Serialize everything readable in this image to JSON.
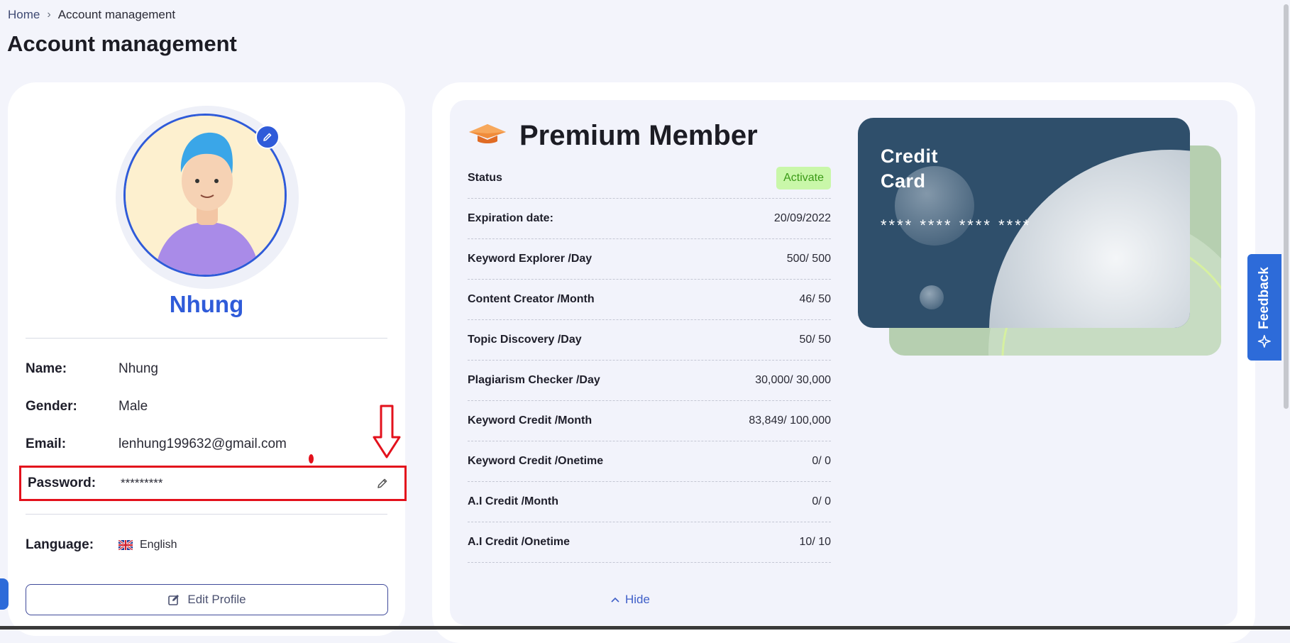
{
  "breadcrumb": {
    "home": "Home",
    "separator": "›",
    "current": "Account management"
  },
  "page_title": "Account management",
  "profile": {
    "name_display": "Nhung",
    "fields": {
      "name_label": "Name:",
      "name_value": "Nhung",
      "gender_label": "Gender:",
      "gender_value": "Male",
      "email_label": "Email:",
      "email_value": "lenhung199632@gmail.com",
      "password_label": "Password:",
      "password_value": "*********",
      "language_label": "Language:",
      "language_value": "English"
    },
    "edit_button": "Edit Profile"
  },
  "membership": {
    "title": "Premium Member",
    "rows": [
      {
        "label": "Status",
        "value": "Activate"
      },
      {
        "label": "Expiration date:",
        "value": "20/09/2022"
      },
      {
        "label": "Keyword Explorer /Day",
        "value": "500/ 500"
      },
      {
        "label": "Content Creator /Month",
        "value": "46/ 50"
      },
      {
        "label": "Topic Discovery /Day",
        "value": "50/ 50"
      },
      {
        "label": "Plagiarism Checker /Day",
        "value": "30,000/ 30,000"
      },
      {
        "label": "Keyword Credit /Month",
        "value": "83,849/ 100,000"
      },
      {
        "label": "Keyword Credit /Onetime",
        "value": "0/ 0"
      },
      {
        "label": "A.I Credit /Month",
        "value": "0/ 0"
      },
      {
        "label": "A.I Credit /Onetime",
        "value": "10/ 10"
      }
    ],
    "hide_label": "Hide"
  },
  "credit_card": {
    "title_line1": "Credit",
    "title_line2": "Card",
    "number": "**** **** **** ****"
  },
  "feedback": {
    "label": "Feedback"
  },
  "colors": {
    "accent": "#2f5bd9",
    "card": "#2f4f6b",
    "card_back": "#b6cfb0",
    "status_bg": "#c9f7a9",
    "highlight": "#e3111c"
  }
}
